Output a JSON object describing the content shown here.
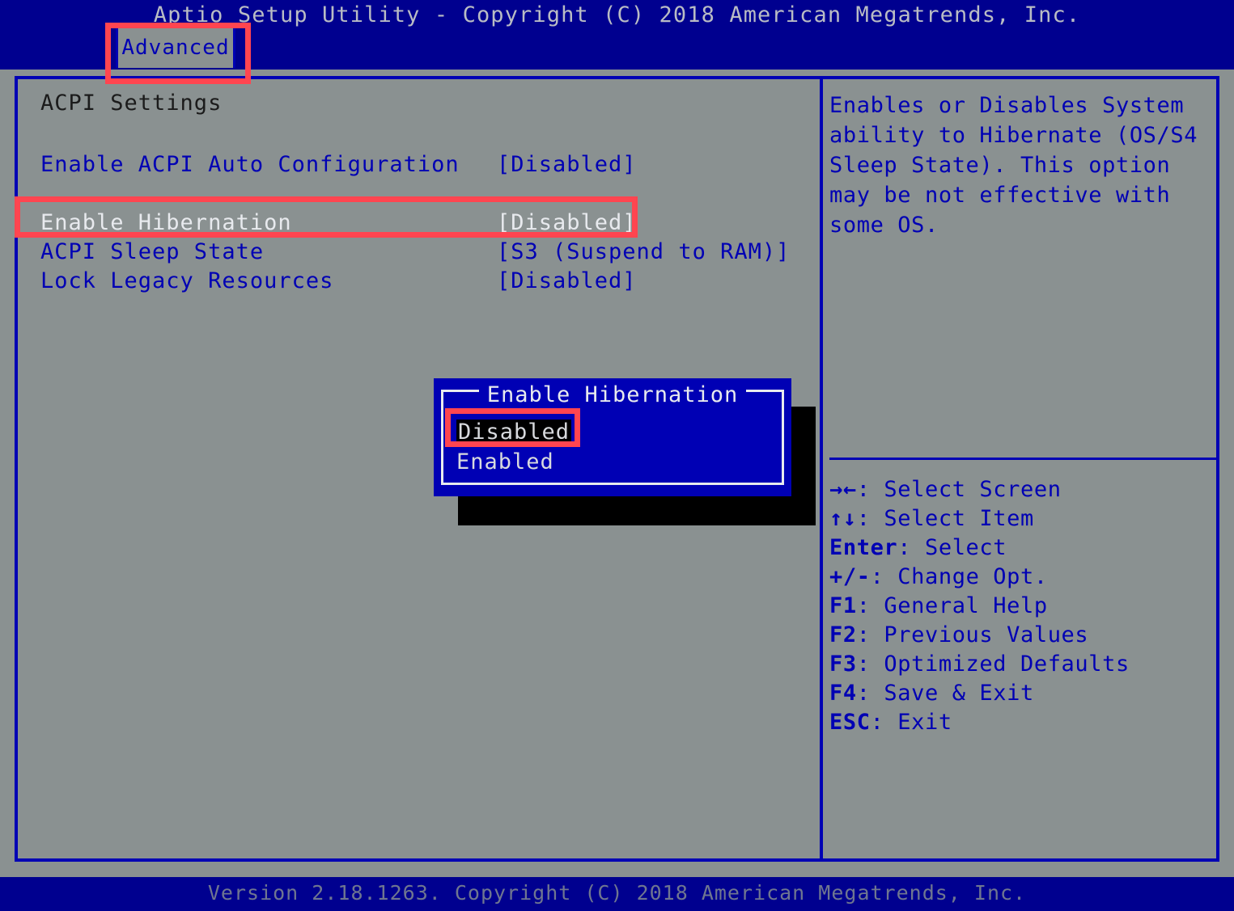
{
  "header": {
    "title": "Aptio Setup Utility - Copyright (C) 2018 American Megatrends, Inc."
  },
  "tabs": [
    {
      "label": "Advanced",
      "active": true
    }
  ],
  "main": {
    "section_title": "ACPI Settings",
    "settings": [
      {
        "label": "Enable ACPI Auto Configuration",
        "value": "[Disabled]",
        "selected": false
      },
      {
        "label": "Enable Hibernation",
        "value": "[Disabled]",
        "selected": true
      },
      {
        "label": "ACPI Sleep State",
        "value": "[S3 (Suspend to RAM)]",
        "selected": false
      },
      {
        "label": "Lock Legacy Resources",
        "value": "[Disabled]",
        "selected": false
      }
    ]
  },
  "help": {
    "text": "Enables or Disables System ability to Hibernate (OS/S4 Sleep State). This option may be not effective with some OS."
  },
  "legend": [
    {
      "key": "→←",
      "label": ": Select Screen"
    },
    {
      "key": "↑↓",
      "label": ": Select Item"
    },
    {
      "key": "Enter",
      "label": ": Select"
    },
    {
      "key": "+/-",
      "label": ": Change Opt."
    },
    {
      "key": "F1",
      "label": ": General Help"
    },
    {
      "key": "F2",
      "label": ": Previous Values"
    },
    {
      "key": "F3",
      "label": ": Optimized Defaults"
    },
    {
      "key": "F4",
      "label": ": Save & Exit"
    },
    {
      "key": "ESC",
      "label": ": Exit"
    }
  ],
  "dialog": {
    "title": "Enable Hibernation",
    "options": [
      {
        "label": "Disabled",
        "selected": true
      },
      {
        "label": "Enabled",
        "selected": false
      }
    ]
  },
  "footer": {
    "text": "Version 2.18.1263. Copyright (C) 2018 American Megatrends, Inc."
  },
  "colors": {
    "title_bar": "#00008f",
    "body": "#8a9191",
    "frame_border": "#0000b4",
    "text_blue": "#0000b4",
    "text_selected": "#e8eaee",
    "dialog_bg": "#0000b4",
    "annotation": "#ff4550"
  }
}
